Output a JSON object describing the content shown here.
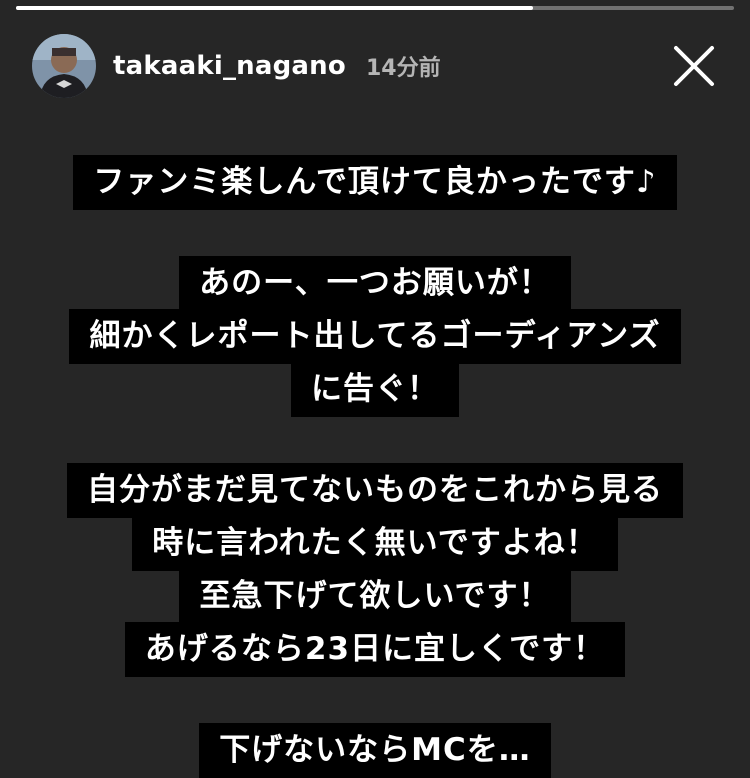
{
  "story": {
    "progress": 0.72,
    "username": "takaaki_nagano",
    "timestamp": "14分前",
    "close_icon": "close-icon",
    "avatar_icon": "avatar"
  },
  "text_blocks": [
    [
      "ファンミ楽しんで頂けて良かったです♪"
    ],
    [
      "あのー、一つお願いが！",
      "細かくレポート出してるゴーディアンズ",
      "に告ぐ！"
    ],
    [
      "自分がまだ見てないものをこれから見る",
      "時に言われたく無いですよね！",
      "至急下げて欲しいです！",
      "あげるなら23日に宜しくです！"
    ],
    [
      "下げないならMCを…"
    ]
  ],
  "colors": {
    "background": "#262626",
    "text_bg": "#000000",
    "text": "#ffffff",
    "timestamp": "#b5b5b5"
  }
}
